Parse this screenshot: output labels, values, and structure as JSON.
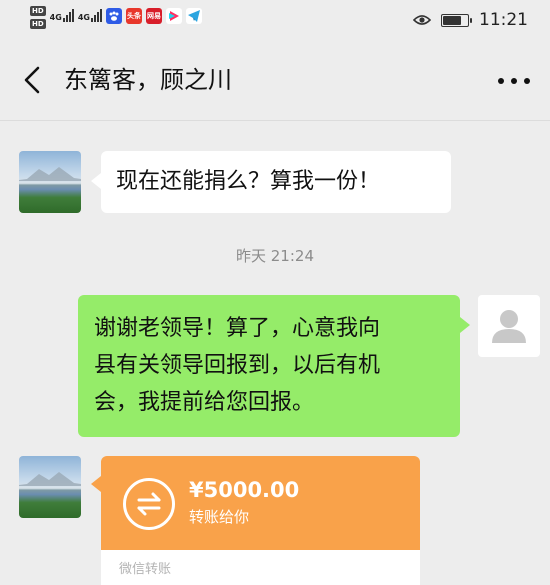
{
  "status_bar": {
    "hd_badges": [
      "HD",
      "HD"
    ],
    "network_labels": [
      "4G",
      "4G"
    ],
    "app_icons": [
      {
        "name": "baidu-app-icon",
        "color": "#2e5be6",
        "label": ""
      },
      {
        "name": "toutiao-app-icon",
        "color": "#e8372b",
        "label": "头条"
      },
      {
        "name": "netease-app-icon",
        "color": "#d81e2a",
        "label": "网易"
      },
      {
        "name": "video-app-icon",
        "color": "#222222",
        "label": ""
      },
      {
        "name": "telegram-app-icon",
        "color": "#2ca5e0",
        "label": ""
      }
    ],
    "time": "11:21",
    "battery_level": 0.8
  },
  "nav": {
    "title": "东篱客，顾之川",
    "back_icon": "chevron-left-icon",
    "more_icon": "ellipsis-icon"
  },
  "messages": {
    "msg1": {
      "text": "现在还能捐么？算我一份！"
    },
    "timestamp": "昨天 21:24",
    "msg2": {
      "lines": [
        "谢谢老领导！算了，心意我向",
        "县有关领导回报到，以后有机",
        "会，我提前给您回报。"
      ]
    },
    "transfer": {
      "amount": "¥5000.00",
      "subtitle": "转账给你",
      "footer": "微信转账"
    }
  },
  "colors": {
    "background": "#ededed",
    "green_bubble": "#95ec69",
    "transfer_orange": "#f9a24a"
  }
}
